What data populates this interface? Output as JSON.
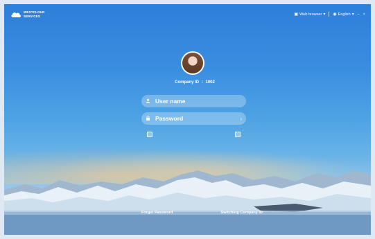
{
  "app": {
    "logo_line1": "WESTCLOUD",
    "logo_line2": "SERVICES"
  },
  "titlebar": {
    "network_label": "Web browser",
    "language_label": "English",
    "minimize_glyph": "–",
    "close_glyph": "×"
  },
  "login": {
    "company_id_label": "Company ID",
    "company_id_value": "1002",
    "username_placeholder": "User name",
    "password_placeholder": "Password"
  },
  "links": {
    "forgot_password": "Forget Password",
    "switch_company": "Switching Company ID"
  },
  "icons": {
    "user": "user-icon",
    "lock": "lock-icon",
    "arrow": "arrow-right-icon",
    "globe": "globe-icon",
    "monitor": "monitor-icon"
  },
  "colors": {
    "sky_top": "#2d7fd9",
    "sky_mid": "#4ea3e4",
    "sky_low": "#b9d6ea",
    "field_bg": "rgba(255,255,255,0.28)"
  }
}
